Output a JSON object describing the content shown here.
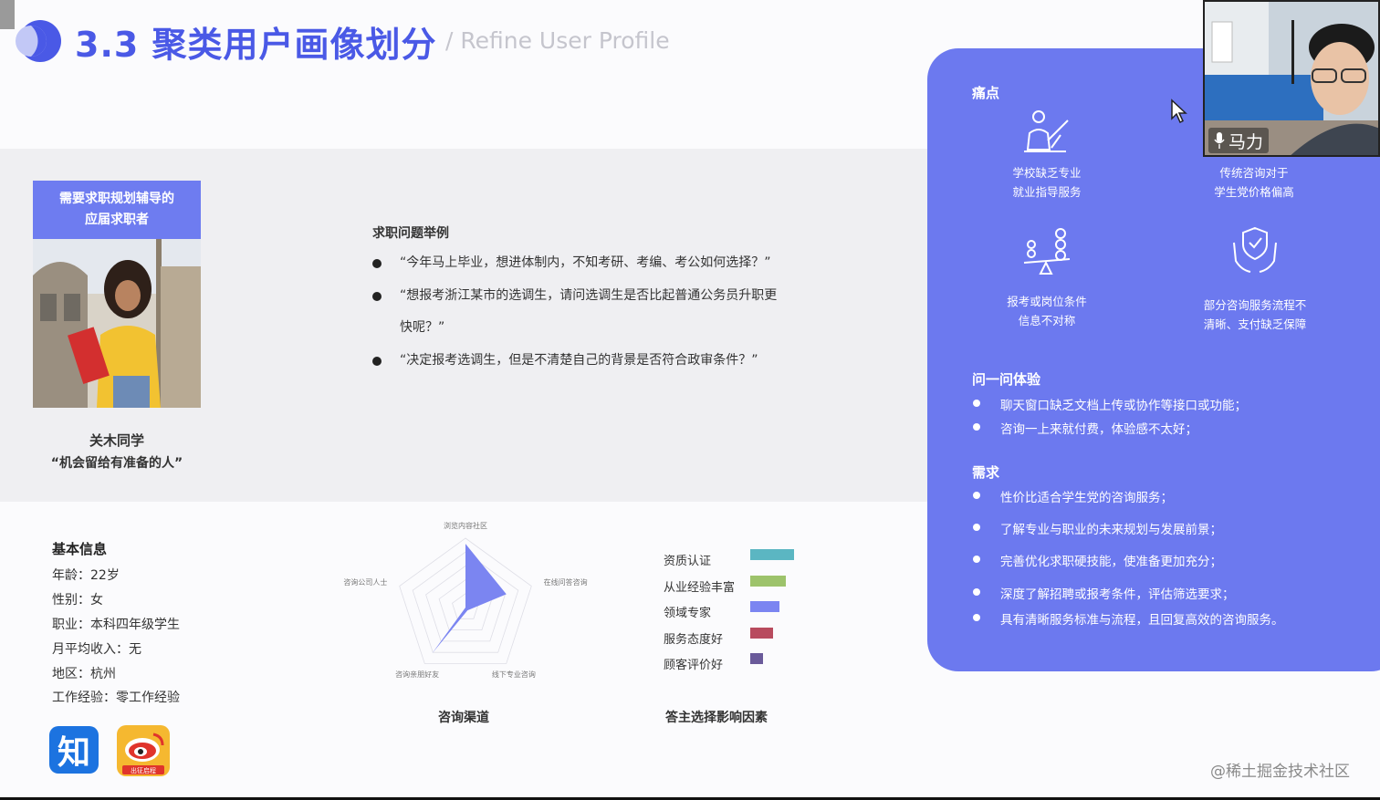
{
  "header": {
    "title": "3.3 聚类用户画像划分",
    "subtitle": "/ Refine User Profile"
  },
  "persona": {
    "tag_line1": "需要求职规划辅导的",
    "tag_line2": "应届求职者",
    "name": "关木同学",
    "quote": "“机会留给有准备的人”"
  },
  "questions": {
    "title": "求职问题举例",
    "items": [
      "“今年马上毕业，想进体制内，不知考研、考编、考公如何选择？”",
      "“想报考浙江某市的选调生，请问选调生是否比起普通公务员升职更",
      "快呢？”",
      "“决定报考选调生，但是不清楚自己的背景是否符合政审条件？”"
    ]
  },
  "basic": {
    "title": "基本信息",
    "items": [
      "年龄：22岁",
      "性别：女",
      "职业：本科四年级学生",
      "月平均收入：无",
      "地区：杭州",
      "工作经验：零工作经验"
    ]
  },
  "apps": {
    "zhihu_label": "知",
    "weibo_label": "出征启程"
  },
  "charts": {
    "radar_title": "咨询渠道",
    "factor_title": "答主选择影响因素"
  },
  "chart_data": [
    {
      "type": "radar",
      "title": "咨询渠道",
      "axes": [
        "浏览内容社区",
        "在线问答咨询",
        "线下专业咨询",
        "咨询亲朋好友",
        "咨询公司人士"
      ],
      "values": [
        0.92,
        0.62,
        0.05,
        0.82,
        0.0
      ],
      "range": [
        0,
        1
      ],
      "color": "#7b85f1"
    },
    {
      "type": "bar",
      "orientation": "horizontal",
      "title": "答主选择影响因素",
      "categories": [
        "资质认证",
        "从业经验丰富",
        "领域专家",
        "服务态度好",
        "顾客评价好"
      ],
      "values": [
        47,
        38,
        31,
        24,
        14
      ],
      "colors": [
        "#5bb6c2",
        "#9dc36b",
        "#7b85f1",
        "#b84b5e",
        "#6a5a9a"
      ]
    }
  ],
  "panel": {
    "pain_title": "痛点",
    "pains": [
      {
        "icon": "teacher-icon",
        "line1": "学校缺乏专业",
        "line2": "就业指导服务"
      },
      {
        "icon": "price-icon",
        "line1": "传统咨询对于",
        "line2": "学生党价格偏高"
      },
      {
        "icon": "balance-icon",
        "line1": "报考或岗位条件",
        "line2": "信息不对称"
      },
      {
        "icon": "shield-hand-icon",
        "line1": "部分咨询服务流程不",
        "line2": "清晰、支付缺乏保障"
      }
    ],
    "exp_title": "问一问体验",
    "exp_items": [
      "聊天窗口缺乏文档上传或协作等接口或功能；",
      "咨询一上来就付费，体验感不太好；"
    ],
    "need_title": "需求",
    "need_items": [
      "性价比适合学生党的咨询服务；",
      "了解专业与职业的未来规划与发展前景；",
      "完善优化求职硬技能，使准备更加充分；",
      "深度了解招聘或报考条件，评估筛选要求；",
      "具有清晰服务标准与流程，且回复高效的咨询服务。"
    ]
  },
  "video": {
    "name": "马力"
  },
  "watermark": "@稀土掘金技术社区",
  "colors": {
    "accent": "#4a59e6",
    "panel": "#6c79ef",
    "band": "#efeff2"
  }
}
